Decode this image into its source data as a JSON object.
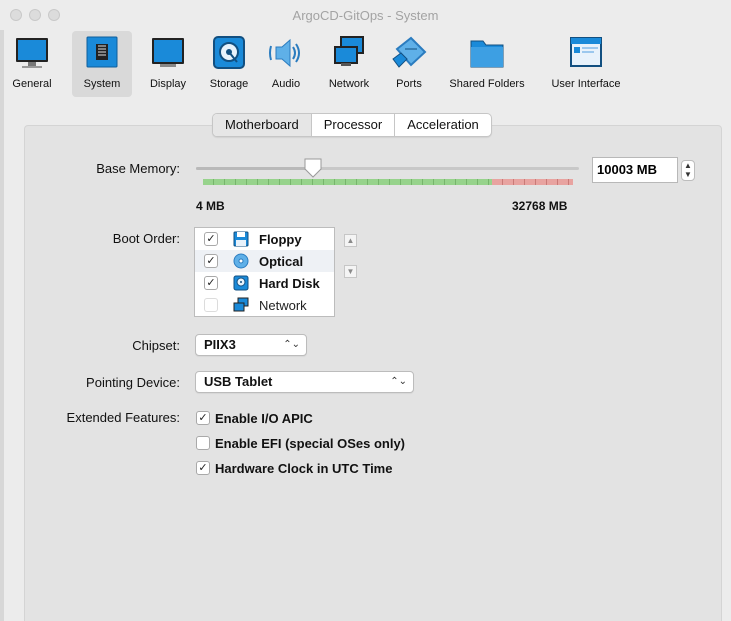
{
  "window": {
    "title": "ArgoCD-GitOps - System"
  },
  "toolbar": {
    "items": [
      {
        "label": "General",
        "icon": "monitor-icon"
      },
      {
        "label": "System",
        "icon": "chip-icon"
      },
      {
        "label": "Display",
        "icon": "display-icon"
      },
      {
        "label": "Storage",
        "icon": "disk-icon"
      },
      {
        "label": "Audio",
        "icon": "speaker-icon"
      },
      {
        "label": "Network",
        "icon": "network-icon"
      },
      {
        "label": "Ports",
        "icon": "ports-icon"
      },
      {
        "label": "Shared Folders",
        "icon": "folder-icon"
      },
      {
        "label": "User Interface",
        "icon": "ui-icon"
      }
    ],
    "selected": "System"
  },
  "tabs": [
    {
      "label": "Motherboard",
      "active": true
    },
    {
      "label": "Processor",
      "active": false
    },
    {
      "label": "Acceleration",
      "active": false
    }
  ],
  "memory": {
    "label": "Base Memory:",
    "value": "10003 MB",
    "value_mb": 10003,
    "min_label": "4 MB",
    "max_label": "32768 MB",
    "min_mb": 4,
    "max_mb": 32768,
    "recommended_max_fraction": 0.78
  },
  "boot_order": {
    "label": "Boot Order:",
    "items": [
      {
        "label": "Floppy",
        "checked": true,
        "icon": "floppy-icon"
      },
      {
        "label": "Optical",
        "checked": true,
        "icon": "optical-icon"
      },
      {
        "label": "Hard Disk",
        "checked": true,
        "icon": "hard-disk-icon"
      },
      {
        "label": "Network",
        "checked": false,
        "icon": "network-icon"
      }
    ],
    "up_glyph": "▲",
    "down_glyph": "▼"
  },
  "chipset": {
    "label": "Chipset:",
    "value": "PIIX3"
  },
  "pointing_device": {
    "label": "Pointing Device:",
    "value": "USB Tablet"
  },
  "extended_features": {
    "label": "Extended Features:",
    "items": [
      {
        "label": "Enable I/O APIC",
        "checked": true
      },
      {
        "label": "Enable EFI (special OSes only)",
        "checked": false
      },
      {
        "label": "Hardware Clock in UTC Time",
        "checked": true
      }
    ]
  },
  "glyphs": {
    "check": "✓",
    "select_arrow": "⌃⌄",
    "step_up": "▲",
    "step_down": "▼"
  },
  "colors": {
    "accent_blue": "#1a8ad9",
    "green_zone": "#97d38c",
    "red_zone": "#e8a3a0"
  }
}
